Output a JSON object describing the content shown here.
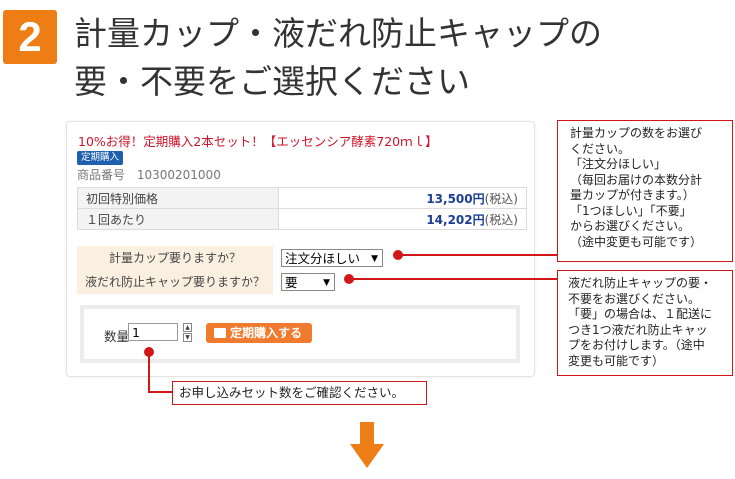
{
  "step": {
    "number": "2",
    "title_line1": "計量カップ・液だれ防止キャップの",
    "title_line2": "要・不要をご選択ください"
  },
  "product": {
    "title": "10%お得！定期購入2本セット！【エッセンシア酵素720ｍｌ】",
    "badge": "定期購入",
    "code_label": "商品番号",
    "code": "10300201000",
    "prices": [
      {
        "label": "初回特別価格",
        "value": "13,500円",
        "tax": "(税込)"
      },
      {
        "label": "１回あたり",
        "value": "14,202円",
        "tax": "(税込)"
      }
    ]
  },
  "options": [
    {
      "label": "計量カップ要りますか？",
      "selected": "注文分ほしい"
    },
    {
      "label": "液だれ防止キャップ要りますか？",
      "selected": "要"
    }
  ],
  "order": {
    "qty_label": "数量",
    "qty_value": "1",
    "button_label": "定期購入する"
  },
  "callouts": {
    "cup": [
      "計量カップの数をお選び",
      "ください。",
      "「注文分ほしい」",
      "（毎回お届けの本数分計",
      "量カップが付きます。）",
      "「1つほしい」「不要」",
      "からお選びください。",
      "（途中変更も可能です）"
    ],
    "cap": [
      "液だれ防止キャップの要・",
      "不要をお選びください。",
      "「要」の場合は、１配送に",
      "つき1つ液だれ防止キャッ",
      "プをお付けします。（途中",
      "変更も可能です）"
    ],
    "qty": "お申し込みセット数をご確認ください。"
  },
  "colors": {
    "accent": "#ef7d15",
    "callout_red": "#d01818",
    "price_blue": "#1b3e94",
    "title_red": "#d0152a"
  }
}
